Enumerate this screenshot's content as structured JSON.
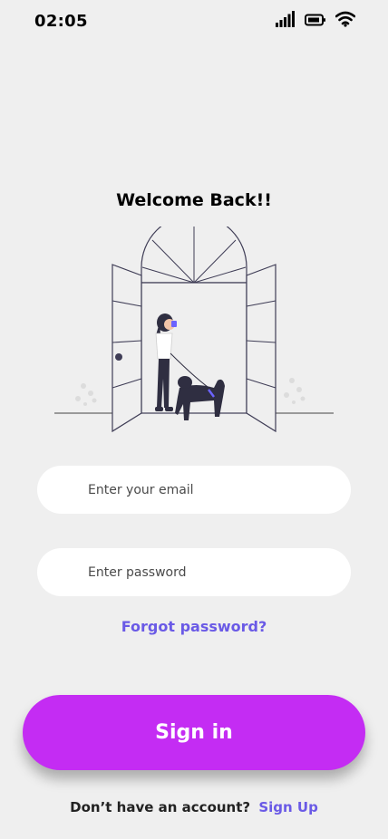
{
  "status": {
    "time": "02:05",
    "icons": [
      "signal-icon",
      "battery-icon",
      "wifi-icon"
    ]
  },
  "welcome": {
    "title": "Welcome Back!!"
  },
  "illustration": {
    "icon": "door-dog-walk-illustration"
  },
  "form": {
    "email_placeholder": "Enter your email",
    "password_placeholder": "Enter password",
    "forgot_label": "Forgot password?"
  },
  "actions": {
    "signin_label": "Sign in"
  },
  "signup": {
    "prompt": "Don’t have an account?",
    "link": "Sign Up"
  },
  "colors": {
    "background": "#efefef",
    "primary": "#c42cf3",
    "link": "#6a5ae6",
    "field": "#ffffff"
  }
}
